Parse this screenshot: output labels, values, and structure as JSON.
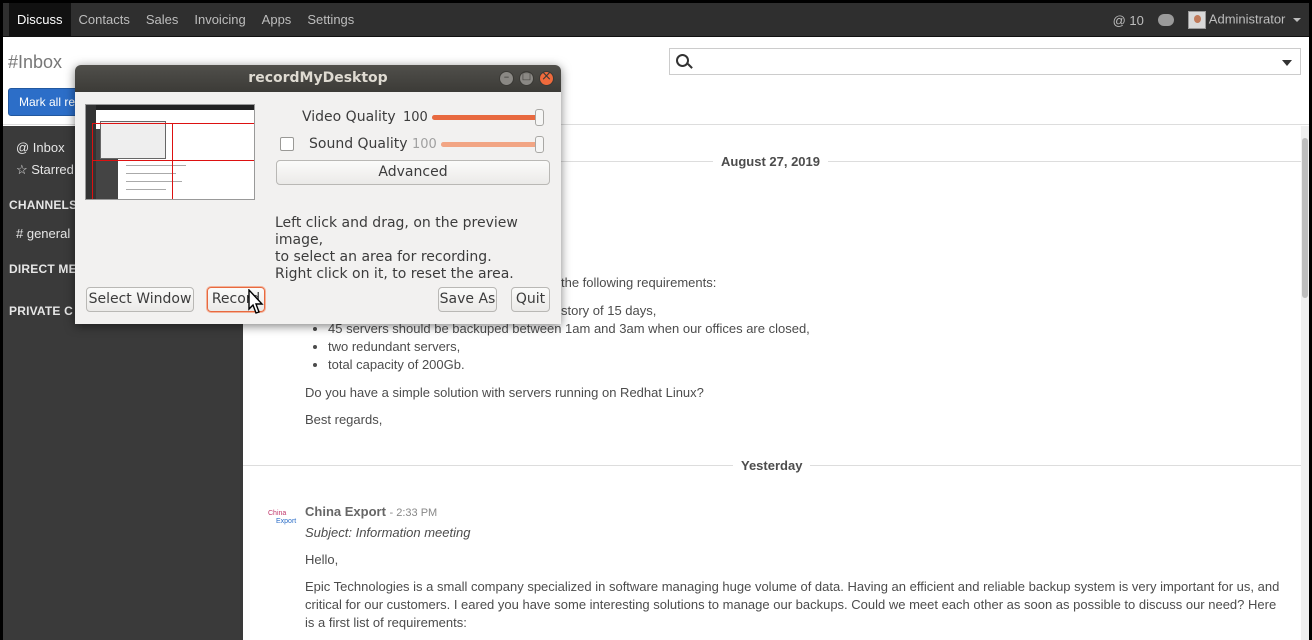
{
  "topnav": {
    "menu": [
      "Discuss",
      "Contacts",
      "Sales",
      "Invoicing",
      "Apps",
      "Settings"
    ],
    "mentions": "@ 10",
    "user": "Administrator"
  },
  "control": {
    "title": "#Inbox",
    "mark_all": "Mark all re"
  },
  "sidebar": {
    "inbox": "@ Inbox",
    "starred": "☆ Starred",
    "channels": "CHANNELS",
    "general": "# general",
    "direct": "DIRECT ME",
    "private": "PRIVATE C"
  },
  "thread": {
    "date1": "August 27, 2019",
    "partial_req": "the following requirements:",
    "partial_b1": "story of 15 days,",
    "bullets": [
      "45 servers should be backuped between 1am and 3am when our offices are closed,",
      "two redundant servers,",
      "total capacity of 200Gb."
    ],
    "question": "Do you have a simple solution with servers running on Redhat Linux?",
    "regards": "Best regards,",
    "date2": "Yesterday",
    "author": "China Export",
    "time": "- 2:33 PM",
    "subject": "Subject: Information meeting",
    "hello": "Hello,",
    "body1": "Epic Technologies is a small company specialized in software managing huge volume of data. Having an efficient and reliable backup system is very important for us, and",
    "body2": "critical for our customers. I eared you have some interesting solutions to manage our backups. Could we meet each other as soon as possible to discuss our need? Here",
    "body3": "is a first list of requirements:",
    "logo_top": "China",
    "logo_bottom": "Export"
  },
  "dialog": {
    "title": "recordMyDesktop",
    "video_label": "Video Quality",
    "video_value": "100",
    "video_level": 1.0,
    "sound_label": "Sound Quality",
    "sound_value": "100",
    "sound_level": 1.0,
    "sound_checked": false,
    "advanced": "Advanced",
    "hint1": "Left click and drag, on the preview image,",
    "hint2": "to select an area for recording.",
    "hint3": "Right click on it, to reset the area.",
    "select_window": "Select Window",
    "record": "Record",
    "save_as": "Save As",
    "quit": "Quit"
  },
  "colors": {
    "accent": "#e8693f",
    "primary": "#2c6ec8",
    "sidebar": "#3a3a3a"
  }
}
